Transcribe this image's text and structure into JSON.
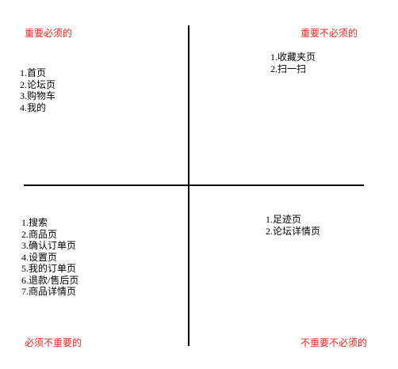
{
  "quadrants": {
    "top_left": {
      "title": "重要必须的",
      "items": [
        "1.首页",
        "2.论坛页",
        "3.购物车",
        "4.我的"
      ]
    },
    "top_right": {
      "title": "重要不必须的",
      "items": [
        "1.收藏夹页",
        "2.扫一扫"
      ]
    },
    "bottom_left": {
      "title": "必须不重要的",
      "items": [
        "1.搜索",
        "2.商品页",
        "3.确认订单页",
        "4.设置页",
        "5.我的订单页",
        "6.退款/售后页",
        "7.商品详情页"
      ]
    },
    "bottom_right": {
      "title": "不重要不必须的",
      "items": [
        "1.足迹页",
        "2.论坛详情页"
      ]
    }
  },
  "colors": {
    "label": "#e8241e",
    "axis": "#000000"
  }
}
